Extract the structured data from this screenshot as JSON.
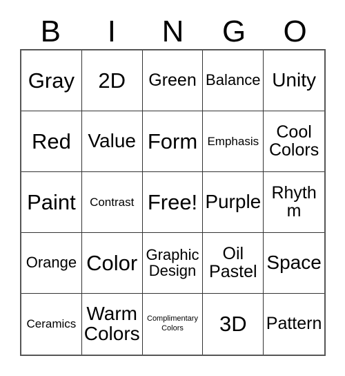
{
  "card": {
    "title": "BINGO",
    "header_letters": [
      "B",
      "I",
      "N",
      "G",
      "O"
    ],
    "free_space_label": "Free!",
    "grid": {
      "rows": 5,
      "columns": 5,
      "cells": [
        {
          "text": "Gray",
          "size": "xxl",
          "row": 1,
          "column": "B"
        },
        {
          "text": "2D",
          "size": "xxl",
          "row": 1,
          "column": "I"
        },
        {
          "text": "Green",
          "size": "lg",
          "row": 1,
          "column": "N"
        },
        {
          "text": "Balance",
          "size": "md",
          "row": 1,
          "column": "G"
        },
        {
          "text": "Unity",
          "size": "xl",
          "row": 1,
          "column": "O"
        },
        {
          "text": "Red",
          "size": "xxl",
          "row": 2,
          "column": "B"
        },
        {
          "text": "Value",
          "size": "xl",
          "row": 2,
          "column": "I"
        },
        {
          "text": "Form",
          "size": "xxl",
          "row": 2,
          "column": "N"
        },
        {
          "text": "Emphasis",
          "size": "sm",
          "row": 2,
          "column": "G"
        },
        {
          "text": "Cool\nColors",
          "size": "lg",
          "row": 2,
          "column": "O"
        },
        {
          "text": "Paint",
          "size": "xxl",
          "row": 3,
          "column": "B"
        },
        {
          "text": "Contrast",
          "size": "sm",
          "row": 3,
          "column": "I"
        },
        {
          "text": "Free!",
          "size": "xxl",
          "row": 3,
          "column": "N"
        },
        {
          "text": "Purple",
          "size": "xl",
          "row": 3,
          "column": "G"
        },
        {
          "text": "Rhythm",
          "size": "lg",
          "row": 3,
          "column": "O"
        },
        {
          "text": "Orange",
          "size": "md",
          "row": 4,
          "column": "B"
        },
        {
          "text": "Color",
          "size": "xxl",
          "row": 4,
          "column": "I"
        },
        {
          "text": "Graphic\nDesign",
          "size": "md",
          "row": 4,
          "column": "N"
        },
        {
          "text": "Oil\nPastel",
          "size": "lg",
          "row": 4,
          "column": "G"
        },
        {
          "text": "Space",
          "size": "xl",
          "row": 4,
          "column": "O"
        },
        {
          "text": "Ceramics",
          "size": "sm",
          "row": 5,
          "column": "B"
        },
        {
          "text": "Warm\nColors",
          "size": "xl",
          "row": 5,
          "column": "I"
        },
        {
          "text": "Complimentary\nColors",
          "size": "xs",
          "row": 5,
          "column": "N"
        },
        {
          "text": "3D",
          "size": "xxl",
          "row": 5,
          "column": "G"
        },
        {
          "text": "Pattern",
          "size": "lg",
          "row": 5,
          "column": "O"
        }
      ]
    },
    "colors": {
      "background": "#ffffff",
      "text": "#000000",
      "grid_line": "#333333",
      "outer_border": "#555555"
    }
  }
}
